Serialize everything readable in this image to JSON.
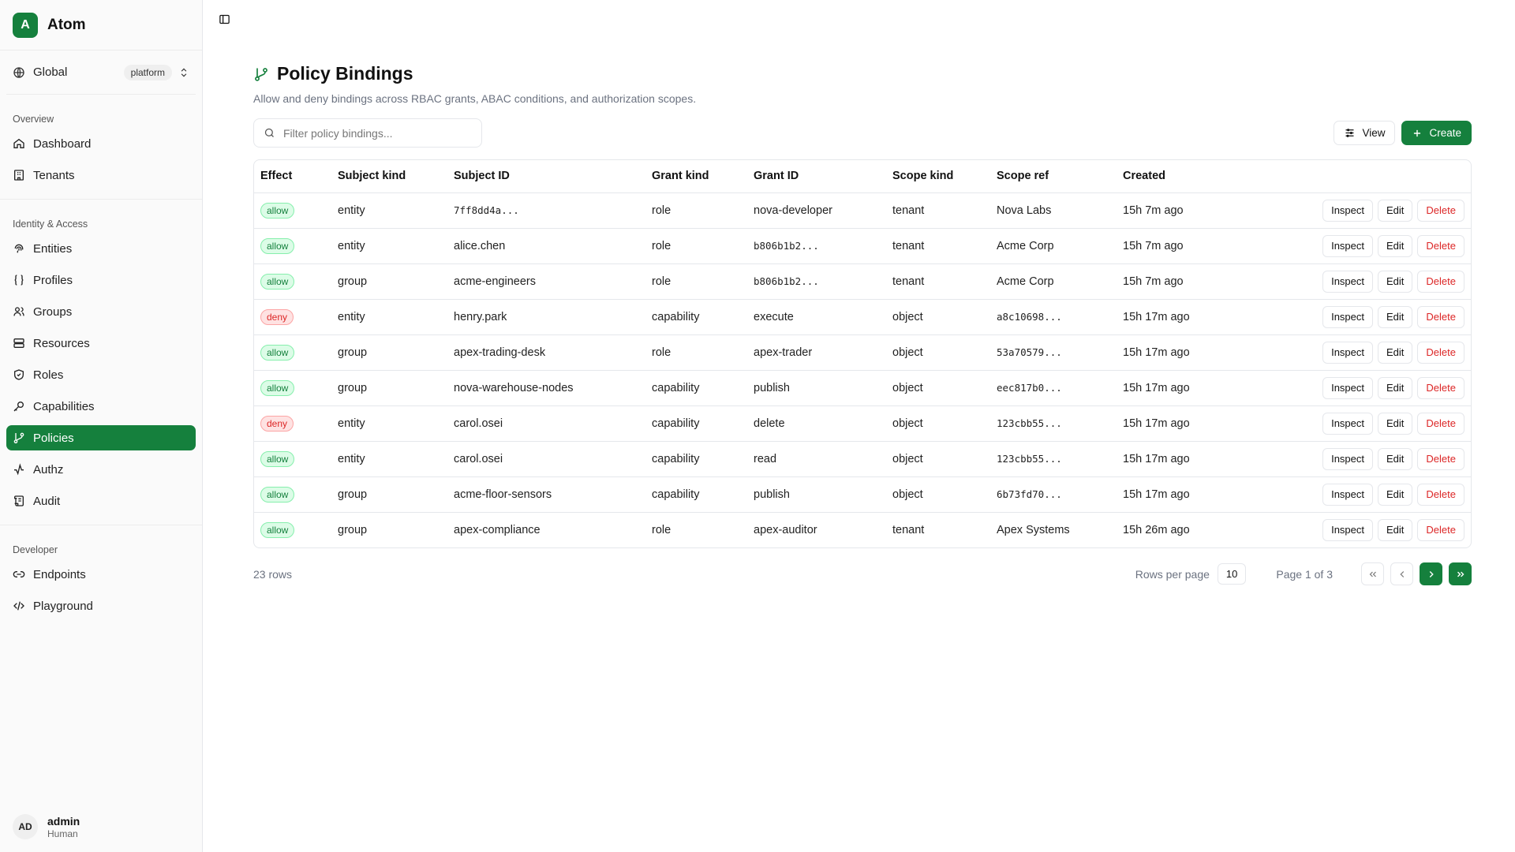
{
  "brand": {
    "logo_letter": "A",
    "name": "Atom",
    "accent": "#15803d"
  },
  "scope": {
    "name": "Global",
    "badge": "platform"
  },
  "sidebar": {
    "sections": [
      {
        "label": "Overview"
      },
      {
        "label": "Identity & Access"
      },
      {
        "label": "Developer"
      }
    ],
    "items": [
      {
        "label": "Dashboard",
        "icon": "home-icon"
      },
      {
        "label": "Tenants",
        "icon": "building-icon"
      },
      {
        "label": "Entities",
        "icon": "fingerprint-icon"
      },
      {
        "label": "Profiles",
        "icon": "braces-icon"
      },
      {
        "label": "Groups",
        "icon": "users-icon"
      },
      {
        "label": "Resources",
        "icon": "server-icon"
      },
      {
        "label": "Roles",
        "icon": "shield-icon"
      },
      {
        "label": "Capabilities",
        "icon": "key-icon"
      },
      {
        "label": "Policies",
        "icon": "git-branch-icon",
        "active": true
      },
      {
        "label": "Authz",
        "icon": "activity-icon"
      },
      {
        "label": "Audit",
        "icon": "scroll-icon"
      },
      {
        "label": "Endpoints",
        "icon": "link-icon"
      },
      {
        "label": "Playground",
        "icon": "code-icon"
      }
    ]
  },
  "user": {
    "initials": "AD",
    "name": "admin",
    "role": "Human"
  },
  "page": {
    "title": "Policy Bindings",
    "subtitle": "Allow and deny bindings across RBAC grants, ABAC conditions, and authorization scopes."
  },
  "toolbar": {
    "search_placeholder": "Filter policy bindings...",
    "view_label": "View",
    "create_label": "Create"
  },
  "table": {
    "columns": [
      "Effect",
      "Subject kind",
      "Subject ID",
      "Grant kind",
      "Grant ID",
      "Scope kind",
      "Scope ref",
      "Created"
    ],
    "rows": [
      {
        "effect": "allow",
        "subject_kind": "entity",
        "subject_id": "7ff8dd4a...",
        "grant_kind": "role",
        "grant_id": "nova-developer",
        "scope_kind": "tenant",
        "scope_ref": "Nova Labs",
        "created": "15h 7m ago"
      },
      {
        "effect": "allow",
        "subject_kind": "entity",
        "subject_id": "alice.chen",
        "grant_kind": "role",
        "grant_id": "b806b1b2...",
        "scope_kind": "tenant",
        "scope_ref": "Acme Corp",
        "created": "15h 7m ago"
      },
      {
        "effect": "allow",
        "subject_kind": "group",
        "subject_id": "acme-engineers",
        "grant_kind": "role",
        "grant_id": "b806b1b2...",
        "scope_kind": "tenant",
        "scope_ref": "Acme Corp",
        "created": "15h 7m ago"
      },
      {
        "effect": "deny",
        "subject_kind": "entity",
        "subject_id": "henry.park",
        "grant_kind": "capability",
        "grant_id": "execute",
        "scope_kind": "object",
        "scope_ref": "a8c10698...",
        "created": "15h 17m ago"
      },
      {
        "effect": "allow",
        "subject_kind": "group",
        "subject_id": "apex-trading-desk",
        "grant_kind": "role",
        "grant_id": "apex-trader",
        "scope_kind": "object",
        "scope_ref": "53a70579...",
        "created": "15h 17m ago"
      },
      {
        "effect": "allow",
        "subject_kind": "group",
        "subject_id": "nova-warehouse-nodes",
        "grant_kind": "capability",
        "grant_id": "publish",
        "scope_kind": "object",
        "scope_ref": "eec817b0...",
        "created": "15h 17m ago"
      },
      {
        "effect": "deny",
        "subject_kind": "entity",
        "subject_id": "carol.osei",
        "grant_kind": "capability",
        "grant_id": "delete",
        "scope_kind": "object",
        "scope_ref": "123cbb55...",
        "created": "15h 17m ago"
      },
      {
        "effect": "allow",
        "subject_kind": "entity",
        "subject_id": "carol.osei",
        "grant_kind": "capability",
        "grant_id": "read",
        "scope_kind": "object",
        "scope_ref": "123cbb55...",
        "created": "15h 17m ago"
      },
      {
        "effect": "allow",
        "subject_kind": "group",
        "subject_id": "acme-floor-sensors",
        "grant_kind": "capability",
        "grant_id": "publish",
        "scope_kind": "object",
        "scope_ref": "6b73fd70...",
        "created": "15h 17m ago"
      },
      {
        "effect": "allow",
        "subject_kind": "group",
        "subject_id": "apex-compliance",
        "grant_kind": "role",
        "grant_id": "apex-auditor",
        "scope_kind": "tenant",
        "scope_ref": "Apex Systems",
        "created": "15h 26m ago"
      }
    ],
    "row_actions": {
      "inspect": "Inspect",
      "edit": "Edit",
      "delete": "Delete"
    }
  },
  "footer": {
    "rows_text": "23 rows",
    "rows_per_page_label": "Rows per page",
    "rows_per_page_value": "10",
    "page_info": "Page 1 of 3"
  }
}
